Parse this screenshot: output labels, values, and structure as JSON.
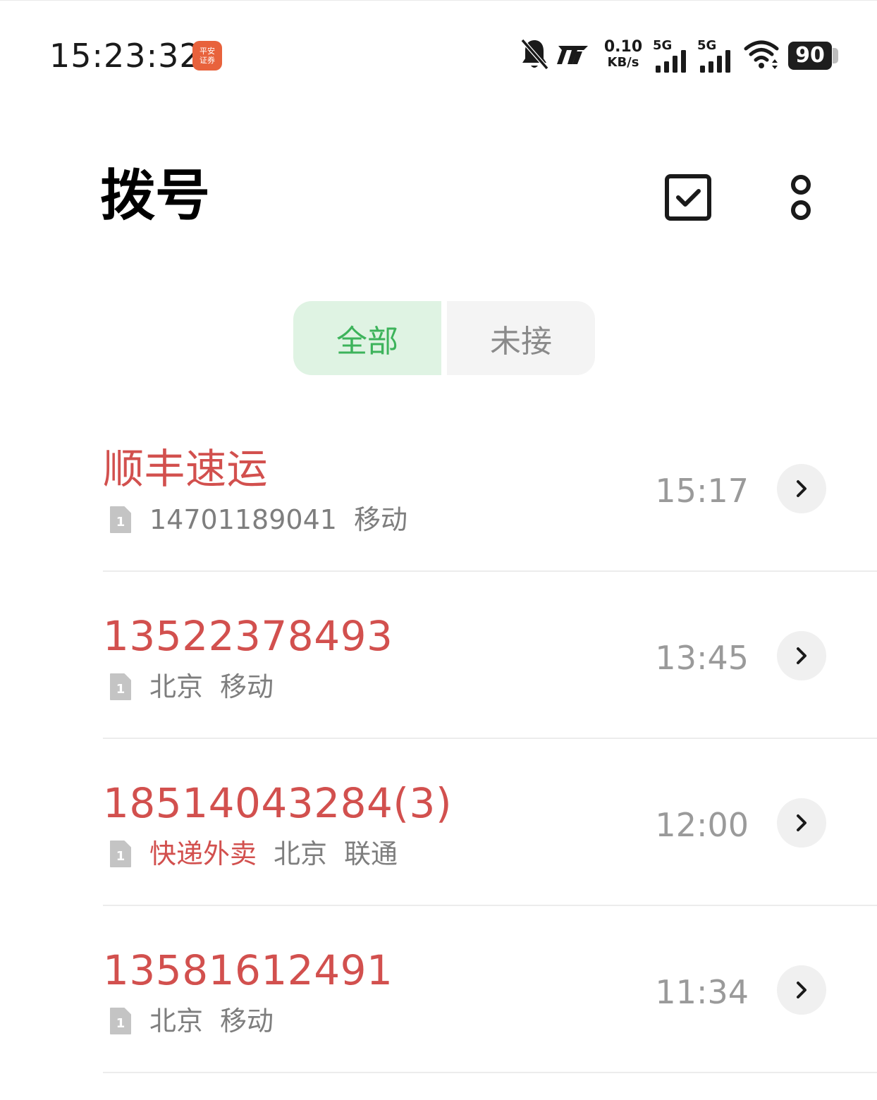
{
  "status_bar": {
    "time": "15:23:32",
    "app_badge_line1": "平安",
    "app_badge_line2": "证券",
    "net_speed_value": "0.10",
    "net_speed_unit": "KB/s",
    "signal1_label": "5G",
    "signal2_label": "5G",
    "battery_level": "90",
    "icons": [
      "bell-muted-icon",
      "network-mode-icon",
      "signal-icon",
      "signal-icon",
      "wifi-icon",
      "battery-icon"
    ]
  },
  "header": {
    "title": "拨号",
    "edit_icon": "checkbox-edit-icon",
    "more_icon": "more-vertical-icon"
  },
  "tabs": [
    {
      "label": "全部",
      "selected": true
    },
    {
      "label": "未接",
      "selected": false
    }
  ],
  "colors": {
    "missed_call_red": "#d2504e",
    "tab_selected_green": "#3db35b",
    "tab_selected_bg": "#dff3e3"
  },
  "calls": [
    {
      "name": "顺丰速运",
      "sim": "1",
      "details": [
        "14701189041",
        "移动"
      ],
      "time": "15:17"
    },
    {
      "name": "13522378493",
      "sim": "1",
      "details": [
        "北京",
        "移动"
      ],
      "time": "13:45"
    },
    {
      "name": "18514043284(3)",
      "sim": "1",
      "tag": "快递外卖",
      "details": [
        "北京",
        "联通"
      ],
      "time": "12:00"
    },
    {
      "name": "13581612491",
      "sim": "1",
      "details": [
        "北京",
        "移动"
      ],
      "time": "11:34"
    }
  ]
}
